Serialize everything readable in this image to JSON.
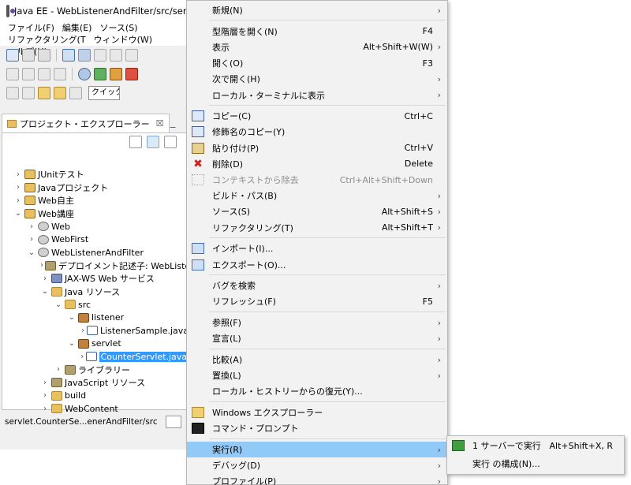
{
  "window": {
    "title": "Java EE - WebListenerAndFilter/src/servlet",
    "menus": [
      "ファイル(F)",
      "編集(E)",
      "ソース(S)",
      "リファクタリング(T",
      "ウィンドウ(W)",
      "ヘルプ(H)"
    ],
    "quick_access": "クイック"
  },
  "explorer": {
    "tab_label": "プロジェクト・エクスプローラー",
    "tab_close": "☒",
    "minimize": "−",
    "items": [
      {
        "label": "JUnitテスト",
        "depth": 0,
        "expanded": false,
        "icon": "project-folder-icon"
      },
      {
        "label": "Javaプロジェクト",
        "depth": 0,
        "expanded": false,
        "icon": "project-folder-icon"
      },
      {
        "label": "Web自主",
        "depth": 0,
        "expanded": false,
        "icon": "project-folder-icon"
      },
      {
        "label": "Web講座",
        "depth": 0,
        "expanded": true,
        "icon": "project-folder-icon"
      },
      {
        "label": "Web",
        "depth": 1,
        "expanded": false,
        "icon": "web-project-icon"
      },
      {
        "label": "WebFirst",
        "depth": 1,
        "expanded": false,
        "icon": "web-project-icon"
      },
      {
        "label": "WebListenerAndFilter",
        "depth": 1,
        "expanded": true,
        "icon": "web-project-icon"
      },
      {
        "label": "デプロイメント記述子: WebListene",
        "depth": 2,
        "expanded": false,
        "icon": "deployment-descriptor-icon"
      },
      {
        "label": "JAX-WS Web サービス",
        "depth": 2,
        "expanded": false,
        "icon": "web-service-icon"
      },
      {
        "label": "Java リソース",
        "depth": 2,
        "expanded": true,
        "icon": "java-resources-icon"
      },
      {
        "label": "src",
        "depth": 3,
        "expanded": true,
        "icon": "source-folder-icon"
      },
      {
        "label": "listener",
        "depth": 4,
        "expanded": true,
        "icon": "package-icon"
      },
      {
        "label": "ListenerSample.java",
        "depth": 5,
        "expanded": false,
        "icon": "java-file-icon"
      },
      {
        "label": "servlet",
        "depth": 4,
        "expanded": true,
        "icon": "package-icon"
      },
      {
        "label": "CounterServlet.java",
        "depth": 5,
        "expanded": false,
        "icon": "java-file-icon",
        "selected": true
      },
      {
        "label": "ライブラリー",
        "depth": 3,
        "expanded": false,
        "icon": "library-icon"
      },
      {
        "label": "JavaScript リソース",
        "depth": 2,
        "expanded": false,
        "icon": "js-resources-icon"
      },
      {
        "label": "build",
        "depth": 2,
        "expanded": false,
        "icon": "folder-icon"
      },
      {
        "label": "WebContent",
        "depth": 2,
        "expanded": false,
        "icon": "folder-icon"
      }
    ]
  },
  "status": {
    "text": "servlet.CounterSe...enerAndFilter/src"
  },
  "context_menu": {
    "items": [
      {
        "label": "新規(N)",
        "key": "",
        "submenu": true
      },
      {
        "label": "型階層を開く(N)",
        "key": "F4",
        "submenu": false,
        "sep_before": true
      },
      {
        "label": "表示",
        "key": "Alt+Shift+W(W)",
        "submenu": true
      },
      {
        "label": "開く(O)",
        "key": "F3",
        "submenu": false
      },
      {
        "label": "次で開く(H)",
        "key": "",
        "submenu": true
      },
      {
        "label": "ローカル・ターミナルに表示",
        "key": "",
        "submenu": true
      },
      {
        "label": "コピー(C)",
        "key": "Ctrl+C",
        "submenu": false,
        "sep_before": true,
        "icon": "copy-icon"
      },
      {
        "label": "修飾名のコピー(Y)",
        "key": "",
        "submenu": false,
        "icon": "copy-qualified-name-icon"
      },
      {
        "label": "貼り付け(P)",
        "key": "Ctrl+V",
        "submenu": false,
        "icon": "paste-icon"
      },
      {
        "label": "削除(D)",
        "key": "Delete",
        "submenu": false,
        "icon": "delete-icon"
      },
      {
        "label": "コンテキストから除去",
        "key": "Ctrl+Alt+Shift+Down",
        "submenu": false,
        "disabled": true,
        "icon": "remove-context-icon"
      },
      {
        "label": "ビルド・パス(B)",
        "key": "",
        "submenu": true
      },
      {
        "label": "ソース(S)",
        "key": "Alt+Shift+S",
        "submenu": true
      },
      {
        "label": "リファクタリング(T)",
        "key": "Alt+Shift+T",
        "submenu": true
      },
      {
        "label": "インポート(I)...",
        "key": "",
        "submenu": false,
        "sep_before": true,
        "icon": "import-icon"
      },
      {
        "label": "エクスポート(O)...",
        "key": "",
        "submenu": false,
        "icon": "export-icon"
      },
      {
        "label": "バグを検索",
        "key": "",
        "submenu": true,
        "sep_before": true
      },
      {
        "label": "リフレッシュ(F)",
        "key": "F5",
        "submenu": false
      },
      {
        "label": "参照(F)",
        "key": "",
        "submenu": true,
        "sep_before": true
      },
      {
        "label": "宣言(L)",
        "key": "",
        "submenu": true
      },
      {
        "label": "比較(A)",
        "key": "",
        "submenu": true,
        "sep_before": true
      },
      {
        "label": "置換(L)",
        "key": "",
        "submenu": true
      },
      {
        "label": "ローカル・ヒストリーからの復元(Y)...",
        "key": "",
        "submenu": false
      },
      {
        "label": "Windows エクスプローラー",
        "key": "",
        "submenu": false,
        "sep_before": true,
        "icon": "windows-explorer-icon"
      },
      {
        "label": "コマンド・プロンプト",
        "key": "",
        "submenu": false,
        "icon": "command-prompt-icon"
      },
      {
        "label": "実行(R)",
        "key": "",
        "submenu": true,
        "sep_before": true,
        "highlight": true
      },
      {
        "label": "デバッグ(D)",
        "key": "",
        "submenu": true
      },
      {
        "label": "プロファイル(P)",
        "key": "",
        "submenu": true
      }
    ]
  },
  "run_submenu": {
    "items": [
      {
        "label": "1 サーバーで実行",
        "key": "Alt+Shift+X, R",
        "icon": "run-on-server-icon"
      },
      {
        "label": "実行 の構成(N)...",
        "key": ""
      }
    ]
  },
  "colors": {
    "selection": "#3399ff",
    "menu_highlight": "#91c9f7"
  }
}
